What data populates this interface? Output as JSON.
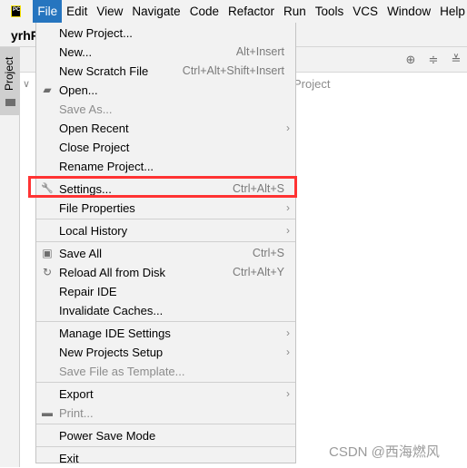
{
  "menubar": {
    "logo": "PC",
    "items": [
      "File",
      "Edit",
      "View",
      "Navigate",
      "Code",
      "Refactor",
      "Run",
      "Tools",
      "VCS",
      "Window",
      "Help"
    ],
    "active": "File"
  },
  "navbar": {
    "project_name": "yrhP"
  },
  "sidebar": {
    "tab_label": "Project"
  },
  "project_panel": {
    "tree_text": "Project",
    "toolbar_icons": [
      "locate-icon",
      "expand-all-icon",
      "collapse-all-icon"
    ]
  },
  "file_menu": {
    "items": [
      {
        "label": "New Project...",
        "shortcut": "",
        "submenu": false,
        "disabled": false,
        "icon": ""
      },
      {
        "label": "New...",
        "shortcut": "Alt+Insert",
        "submenu": false,
        "disabled": false,
        "icon": ""
      },
      {
        "label": "New Scratch File",
        "shortcut": "Ctrl+Alt+Shift+Insert",
        "submenu": false,
        "disabled": false,
        "icon": ""
      },
      {
        "label": "Open...",
        "shortcut": "",
        "submenu": false,
        "disabled": false,
        "icon": "folder-open-icon"
      },
      {
        "label": "Save As...",
        "shortcut": "",
        "submenu": false,
        "disabled": true,
        "icon": ""
      },
      {
        "label": "Open Recent",
        "shortcut": "",
        "submenu": true,
        "disabled": false,
        "icon": ""
      },
      {
        "label": "Close Project",
        "shortcut": "",
        "submenu": false,
        "disabled": false,
        "icon": ""
      },
      {
        "label": "Rename Project...",
        "shortcut": "",
        "submenu": false,
        "disabled": false,
        "icon": ""
      },
      {
        "separator": true
      },
      {
        "label": "Settings...",
        "shortcut": "Ctrl+Alt+S",
        "submenu": false,
        "disabled": false,
        "icon": "wrench-icon",
        "highlighted": true
      },
      {
        "label": "File Properties",
        "shortcut": "",
        "submenu": true,
        "disabled": false,
        "icon": ""
      },
      {
        "separator": true
      },
      {
        "label": "Local History",
        "shortcut": "",
        "submenu": true,
        "disabled": false,
        "icon": ""
      },
      {
        "separator": true
      },
      {
        "label": "Save All",
        "shortcut": "Ctrl+S",
        "submenu": false,
        "disabled": false,
        "icon": "save-icon"
      },
      {
        "label": "Reload All from Disk",
        "shortcut": "Ctrl+Alt+Y",
        "submenu": false,
        "disabled": false,
        "icon": "reload-icon"
      },
      {
        "label": "Repair IDE",
        "shortcut": "",
        "submenu": false,
        "disabled": false,
        "icon": ""
      },
      {
        "label": "Invalidate Caches...",
        "shortcut": "",
        "submenu": false,
        "disabled": false,
        "icon": ""
      },
      {
        "separator": true
      },
      {
        "label": "Manage IDE Settings",
        "shortcut": "",
        "submenu": true,
        "disabled": false,
        "icon": ""
      },
      {
        "label": "New Projects Setup",
        "shortcut": "",
        "submenu": true,
        "disabled": false,
        "icon": ""
      },
      {
        "label": "Save File as Template...",
        "shortcut": "",
        "submenu": false,
        "disabled": true,
        "icon": ""
      },
      {
        "separator": true
      },
      {
        "label": "Export",
        "shortcut": "",
        "submenu": true,
        "disabled": false,
        "icon": ""
      },
      {
        "label": "Print...",
        "shortcut": "",
        "submenu": false,
        "disabled": true,
        "icon": "print-icon"
      },
      {
        "separator": true
      },
      {
        "label": "Power Save Mode",
        "shortcut": "",
        "submenu": false,
        "disabled": false,
        "icon": ""
      },
      {
        "separator": true
      },
      {
        "label": "Exit",
        "shortcut": "",
        "submenu": false,
        "disabled": false,
        "icon": ""
      }
    ]
  },
  "annotation": {
    "color": "#ff3333"
  },
  "watermark": "CSDN @西海燃风",
  "colors": {
    "menu_active": "#2675bf",
    "menu_bg": "#f2f2f2"
  }
}
